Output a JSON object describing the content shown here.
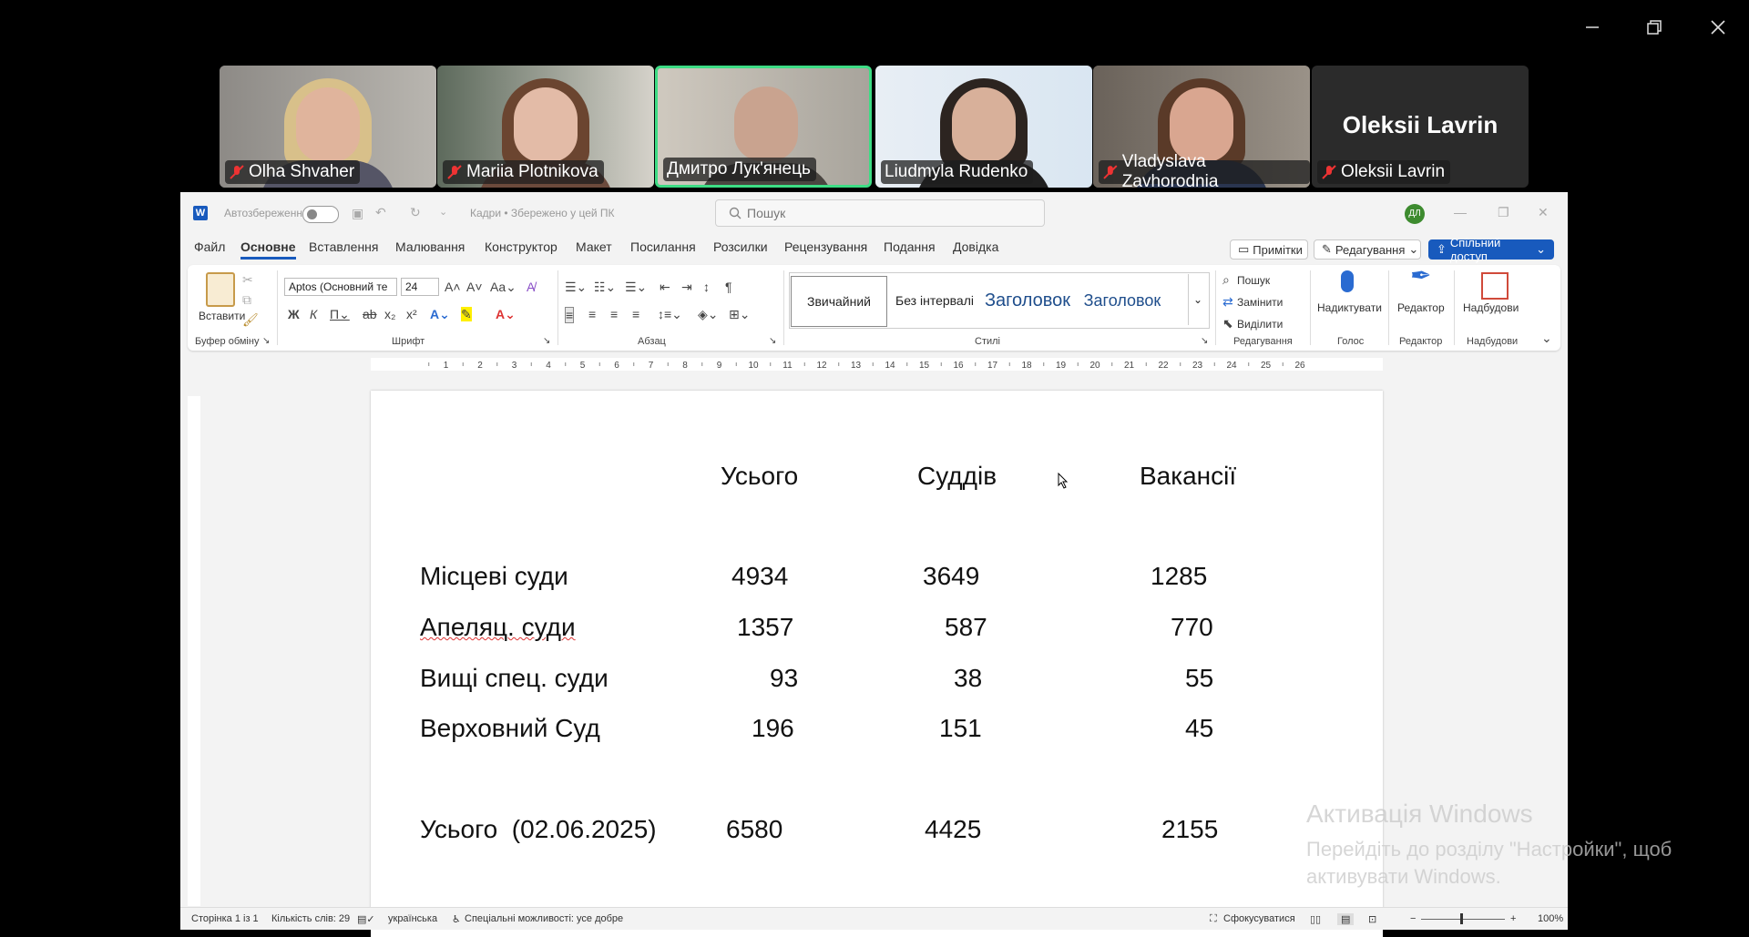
{
  "participants": [
    {
      "name": "Olha Shvaher",
      "muted": true
    },
    {
      "name": "Mariia Plotnikova",
      "muted": true
    },
    {
      "name": "Дмитро Лук'янець",
      "muted": false,
      "active": true
    },
    {
      "name": "Liudmyla Rudenko",
      "muted": false
    },
    {
      "name": "Vladyslava Zavhorodnia",
      "muted": true
    },
    {
      "name": "Oleksii Lavrin",
      "muted": true,
      "video_off_label": "Oleksii Lavrin"
    }
  ],
  "word": {
    "autosave_label": "Автозбереження",
    "doc_title": "Кадри • Збережено у цей ПК",
    "search_placeholder": "Пошук",
    "avatar_initials": "ДЛ",
    "menu": [
      "Файл",
      "Основне",
      "Вставлення",
      "Малювання",
      "Конструктор",
      "Макет",
      "Посилання",
      "Розсилки",
      "Рецензування",
      "Подання",
      "Довідка"
    ],
    "right_buttons": {
      "comments": "Примітки",
      "editing": "Редагування",
      "share": "Спільний доступ"
    },
    "ribbon": {
      "paste_label": "Вставити",
      "clipboard_group": "Буфер обміну",
      "font_name": "Aptos (Основний те",
      "font_size": "24",
      "font_group": "Шрифт",
      "paragraph_group": "Абзац",
      "styles": [
        "Звичайний",
        "Без інтервалі",
        "Заголовок",
        "Заголовок"
      ],
      "styles_group": "Стилі",
      "find_label": "Пошук",
      "replace_label": "Замінити",
      "select_label": "Виділити",
      "editing_group": "Редагування",
      "dictate_label": "Надиктувати",
      "voice_group": "Голос",
      "editor_label": "Редактор",
      "editor_group": "Редактор",
      "addins_label": "Надбудови",
      "addins_group": "Надбудови"
    },
    "ruler_numbers": [
      "1",
      "2",
      "3",
      "4",
      "5",
      "6",
      "7",
      "8",
      "9",
      "10",
      "11",
      "12",
      "13",
      "14",
      "15",
      "16",
      "17",
      "18",
      "19",
      "20",
      "21",
      "22",
      "23",
      "24",
      "25",
      "26"
    ],
    "table": {
      "headers": [
        "Усього",
        "Суддів",
        "Вакансії"
      ],
      "rows": [
        {
          "label": "Місцеві суди",
          "total": "4934",
          "judges": "3649",
          "vacancies": "1285"
        },
        {
          "label": "Апеляц. суди",
          "total": "1357",
          "judges": "587",
          "vacancies": "770"
        },
        {
          "label": "Вищі спец. суди",
          "total": "93",
          "judges": "38",
          "vacancies": "55"
        },
        {
          "label": "Верховний Суд",
          "total": "196",
          "judges": "151",
          "vacancies": "45"
        }
      ],
      "summary": {
        "label": "Усього  (02.06.2025)",
        "total": "6580",
        "judges": "4425",
        "vacancies": "2155"
      }
    },
    "status": {
      "page": "Сторінка 1 із 1",
      "words": "Кількість слів: 29",
      "language": "українська",
      "accessibility": "Спеціальні можливості: усе добре",
      "focus": "Сфокусуватися",
      "zoom": "100%"
    }
  },
  "watermark": {
    "line1": "Активація Windows",
    "line2": "Перейдіть до розділу \"Настройки\", щоб активувати Windows."
  }
}
